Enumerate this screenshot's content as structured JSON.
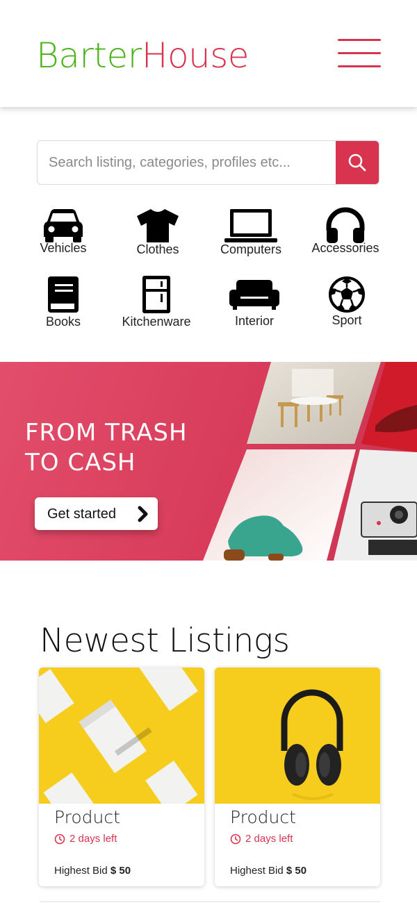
{
  "header": {
    "logo_part1": "Barter",
    "logo_part2": "House",
    "menu_icon": "hamburger-menu-icon"
  },
  "search": {
    "placeholder": "Search listing, categories, profiles etc...",
    "value": "",
    "button_icon": "search-icon"
  },
  "categories": [
    {
      "label": "Vehicles",
      "icon": "car-icon"
    },
    {
      "label": "Clothes",
      "icon": "shirt-icon"
    },
    {
      "label": "Computers",
      "icon": "laptop-icon"
    },
    {
      "label": "Accessories",
      "icon": "headphones-icon"
    },
    {
      "label": "Books",
      "icon": "book-icon"
    },
    {
      "label": "Kitchenware",
      "icon": "fridge-icon"
    },
    {
      "label": "Interior",
      "icon": "sofa-icon"
    },
    {
      "label": "Sport",
      "icon": "soccer-ball-icon"
    }
  ],
  "banner": {
    "title_line1": "FROM TRASH",
    "title_line2": "TO CASH",
    "cta_label": "Get started"
  },
  "listings": {
    "title": "Newest Listings",
    "items": [
      {
        "title": "Product",
        "time_left": "2 days left",
        "bid_label": "Highest Bid",
        "bid_value": "$ 50"
      },
      {
        "title": "Product",
        "time_left": "2 days left",
        "bid_label": "Highest Bid",
        "bid_value": "$ 50"
      }
    ]
  },
  "colors": {
    "brand_green": "#4db31a",
    "brand_red": "#d8344f",
    "banner": "#e14a66",
    "listing_bg": "#f7d21a"
  }
}
